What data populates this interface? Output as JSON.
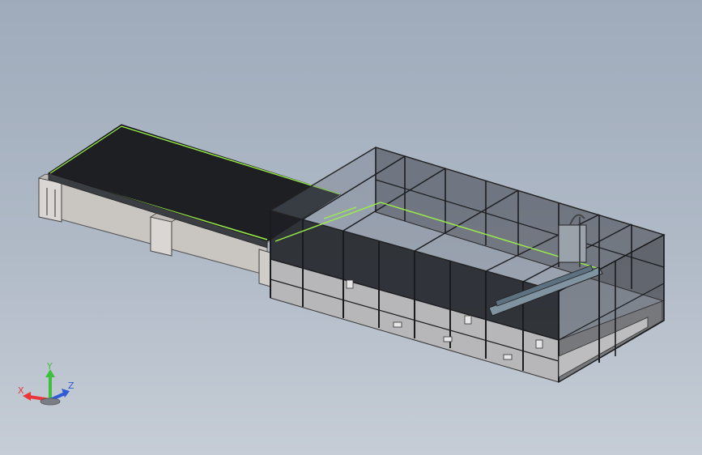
{
  "viewport": {
    "background_top": "#9fabbb",
    "background_bottom": "#c6cdd6"
  },
  "model": {
    "frame_color": "#2a2c31",
    "glass_color": "#1e2024",
    "highlight_color": "#9cf04a",
    "base_color": "#c9c5c1"
  },
  "triad": {
    "x_label": "X",
    "y_label": "Y",
    "z_label": "Z",
    "x_color": "#e8363a",
    "y_color": "#3fbf3f",
    "z_color": "#2f5bd6"
  }
}
